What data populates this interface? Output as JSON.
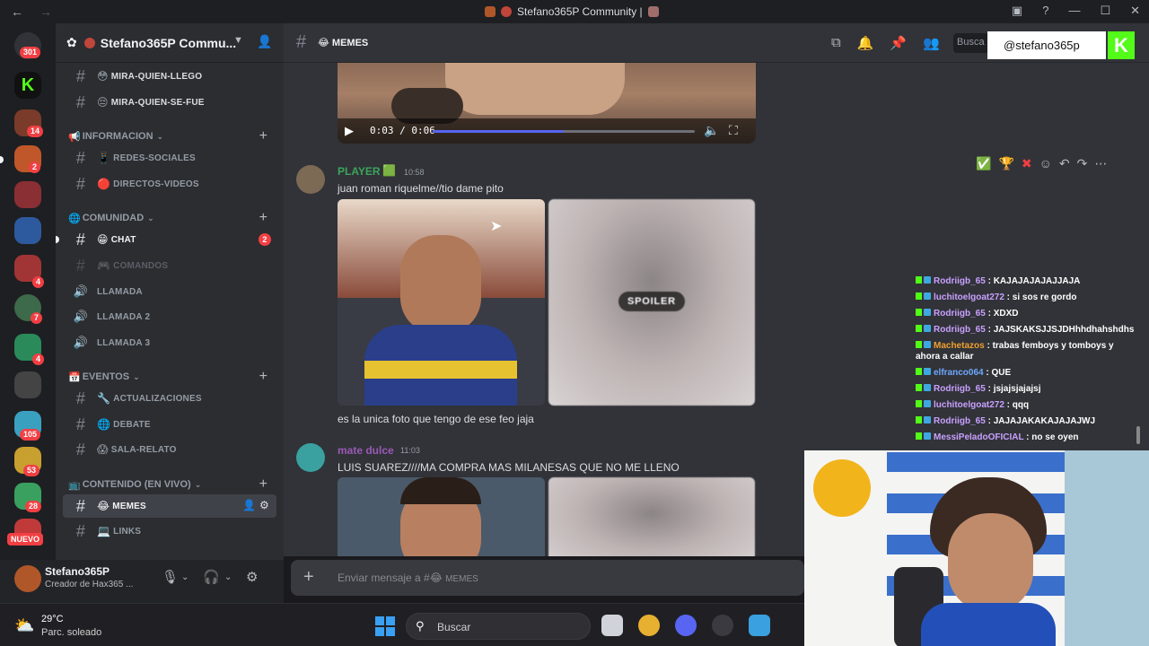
{
  "window": {
    "title": "Stefano365P Community |",
    "nav_back": "←",
    "nav_forward": "→",
    "controls": [
      "—",
      "☐",
      "✕"
    ]
  },
  "rail": {
    "top_badge": "301",
    "badges": [
      "14",
      "2",
      "4",
      "7",
      "4",
      "105",
      "53",
      "28"
    ],
    "new_label": "NUEVO"
  },
  "server": {
    "name": "Stefano365P Commu...",
    "categories": {
      "informacion": "INFORMACION",
      "comunidad": "COMUNIDAD",
      "eventos": "EVENTOS",
      "contenido": "CONTENIDO (EN VIVO)"
    },
    "channels": {
      "mira_quien_llego": "MIRA-QUIEN-LLEGO",
      "mira_quien_se_fue": "MIRA-QUIEN-SE-FUE",
      "redes_sociales": "REDES-SOCIALES",
      "directos_videos": "DIRECTOS-VIDEOS",
      "chat": "CHAT",
      "chat_unread": "2",
      "comandos": "COMANDOS",
      "llamada": "LLAMADA",
      "llamada2": "LLAMADA 2",
      "llamada3": "LLAMADA 3",
      "actualizaciones": "ACTUALIZACIONES",
      "debate": "DEBATE",
      "sala_relato": "SALA-RELATO",
      "memes": "MEMES",
      "links": "LINKS"
    }
  },
  "user": {
    "name": "Stefano365P",
    "status": "Creador de Hax365 ..."
  },
  "chat_header": {
    "channel": "MEMES",
    "search_placeholder": "Busca"
  },
  "video": {
    "time": "0:03 / 0:06",
    "progress": 0.5
  },
  "messages": [
    {
      "author": "PLAYER",
      "author_color": "#3ba55c",
      "time": "10:58",
      "text": "juan roman riquelme//tio dame pito",
      "spoiler_label": "SPOILER",
      "followup": "es la unica foto que tengo de ese feo jaja"
    },
    {
      "author": "mate dulce",
      "author_color": "#9b59b6",
      "time": "11:03",
      "text": "LUIS SUAREZ////MA COMPRA MAS MILANESAS QUE NO ME LLENO"
    }
  ],
  "composer": {
    "placeholder": "Enviar mensaje a #",
    "channel": "MEMES"
  },
  "overlay": {
    "handle": "@stefano365p",
    "logo": "K"
  },
  "stream_chat": [
    {
      "user": "Rodriigb_65",
      "text": "KAJAJAJAJAJJAJA",
      "color": "#c9a0ff"
    },
    {
      "user": "luchitoelgoat272",
      "text": "si sos re gordo",
      "color": "#c9a0ff"
    },
    {
      "user": "Rodriigb_65",
      "text": "XDXD",
      "color": "#c9a0ff"
    },
    {
      "user": "Rodriigb_65",
      "text": "JAJSKAKSJJSJDHhhdhahshdhs",
      "color": "#c9a0ff"
    },
    {
      "user": "Machetazos",
      "text": "trabas femboys y tomboys y ahora a callar",
      "color": "#f0a030"
    },
    {
      "user": "elfranco064",
      "text": "QUE",
      "color": "#6fa8ff"
    },
    {
      "user": "Rodriigb_65",
      "text": "jsjajsjajajsj",
      "color": "#c9a0ff"
    },
    {
      "user": "luchitoelgoat272",
      "text": "qqq",
      "color": "#c9a0ff"
    },
    {
      "user": "Rodriigb_65",
      "text": "JAJAJAKAKAJAJAJWJ",
      "color": "#c9a0ff"
    },
    {
      "user": "MessiPeladoOFICIAL",
      "text": "no se oyen",
      "color": "#c9a0ff"
    }
  ],
  "taskbar": {
    "temperature": "29°C",
    "condition": "Parc. soleado",
    "search": "Buscar"
  },
  "colors": {
    "discord_bg": "#313338",
    "sidebar_bg": "#2b2d31",
    "accent": "#5865f2",
    "kick_green": "#53fc18",
    "mention_red": "#f23f43"
  }
}
